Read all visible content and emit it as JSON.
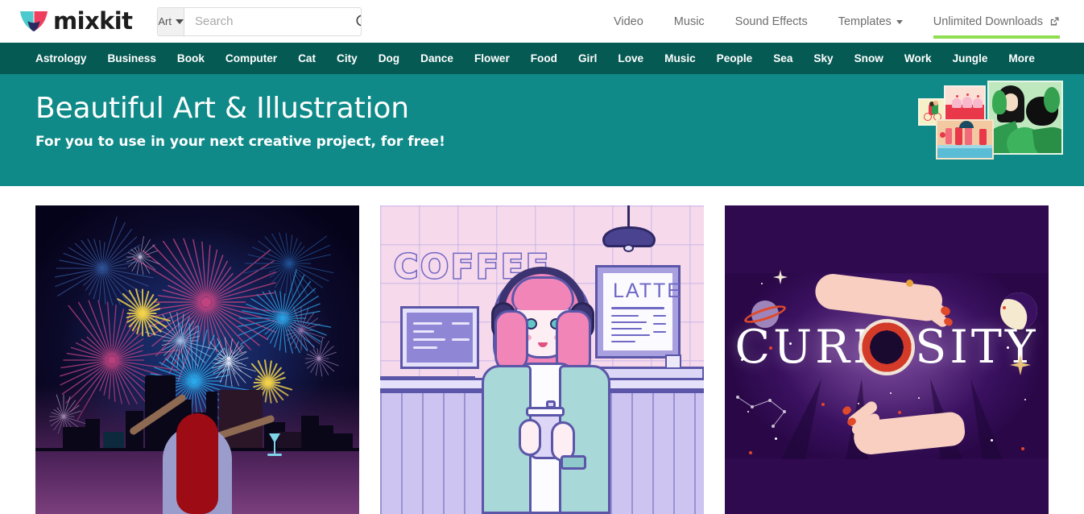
{
  "header": {
    "logo_text": "mixkit",
    "logo_icon": "butterfly-logo-icon",
    "search": {
      "category_label": "Art",
      "category_icon": "chevron-down-icon",
      "placeholder": "Search",
      "value": "",
      "search_icon": "search-icon"
    },
    "nav": [
      {
        "label": "Video",
        "has_dropdown": false,
        "external": false,
        "accent": false
      },
      {
        "label": "Music",
        "has_dropdown": false,
        "external": false,
        "accent": false
      },
      {
        "label": "Sound Effects",
        "has_dropdown": false,
        "external": false,
        "accent": false
      },
      {
        "label": "Templates",
        "has_dropdown": true,
        "external": false,
        "accent": false
      },
      {
        "label": "Unlimited Downloads",
        "has_dropdown": false,
        "external": true,
        "accent": true
      }
    ],
    "external_link_icon": "external-link-icon"
  },
  "categories": [
    "Astrology",
    "Business",
    "Book",
    "Computer",
    "Cat",
    "City",
    "Dog",
    "Dance",
    "Flower",
    "Food",
    "Girl",
    "Love",
    "Music",
    "People",
    "Sea",
    "Sky",
    "Snow",
    "Work",
    "Jungle",
    "More"
  ],
  "hero": {
    "title": "Beautiful Art & Illustration",
    "subtitle": "For you to use in your next creative project, for free!",
    "collage": [
      {
        "name": "thumb-couple-on-bike"
      },
      {
        "name": "thumb-cupcakes"
      },
      {
        "name": "thumb-beach-towels"
      },
      {
        "name": "thumb-woman-in-leaves"
      }
    ]
  },
  "cards": [
    {
      "name": "card-fireworks-city",
      "alt": "Fireworks over a city skyline with a woman raising her arms",
      "caption": ""
    },
    {
      "name": "card-coffee-shop-girl",
      "alt": "Girl with pink hair and headphones in a coffee shop",
      "signs": {
        "wall_word": "COFFEE",
        "menu_word": "LATTE"
      },
      "caption": ""
    },
    {
      "name": "card-curiosity",
      "alt": "Mystical hands, eye, moon and planet with the word CURIOSITY",
      "title_word": "CURIOSITY",
      "caption": ""
    }
  ],
  "colors": {
    "nav_teal": "#065a54",
    "hero_teal": "#0f8a88",
    "accent_green": "#8ede4f",
    "logo_cyan": "#4cc9cd",
    "logo_pink": "#ef3f5f",
    "logo_navy": "#2b2a5e"
  }
}
